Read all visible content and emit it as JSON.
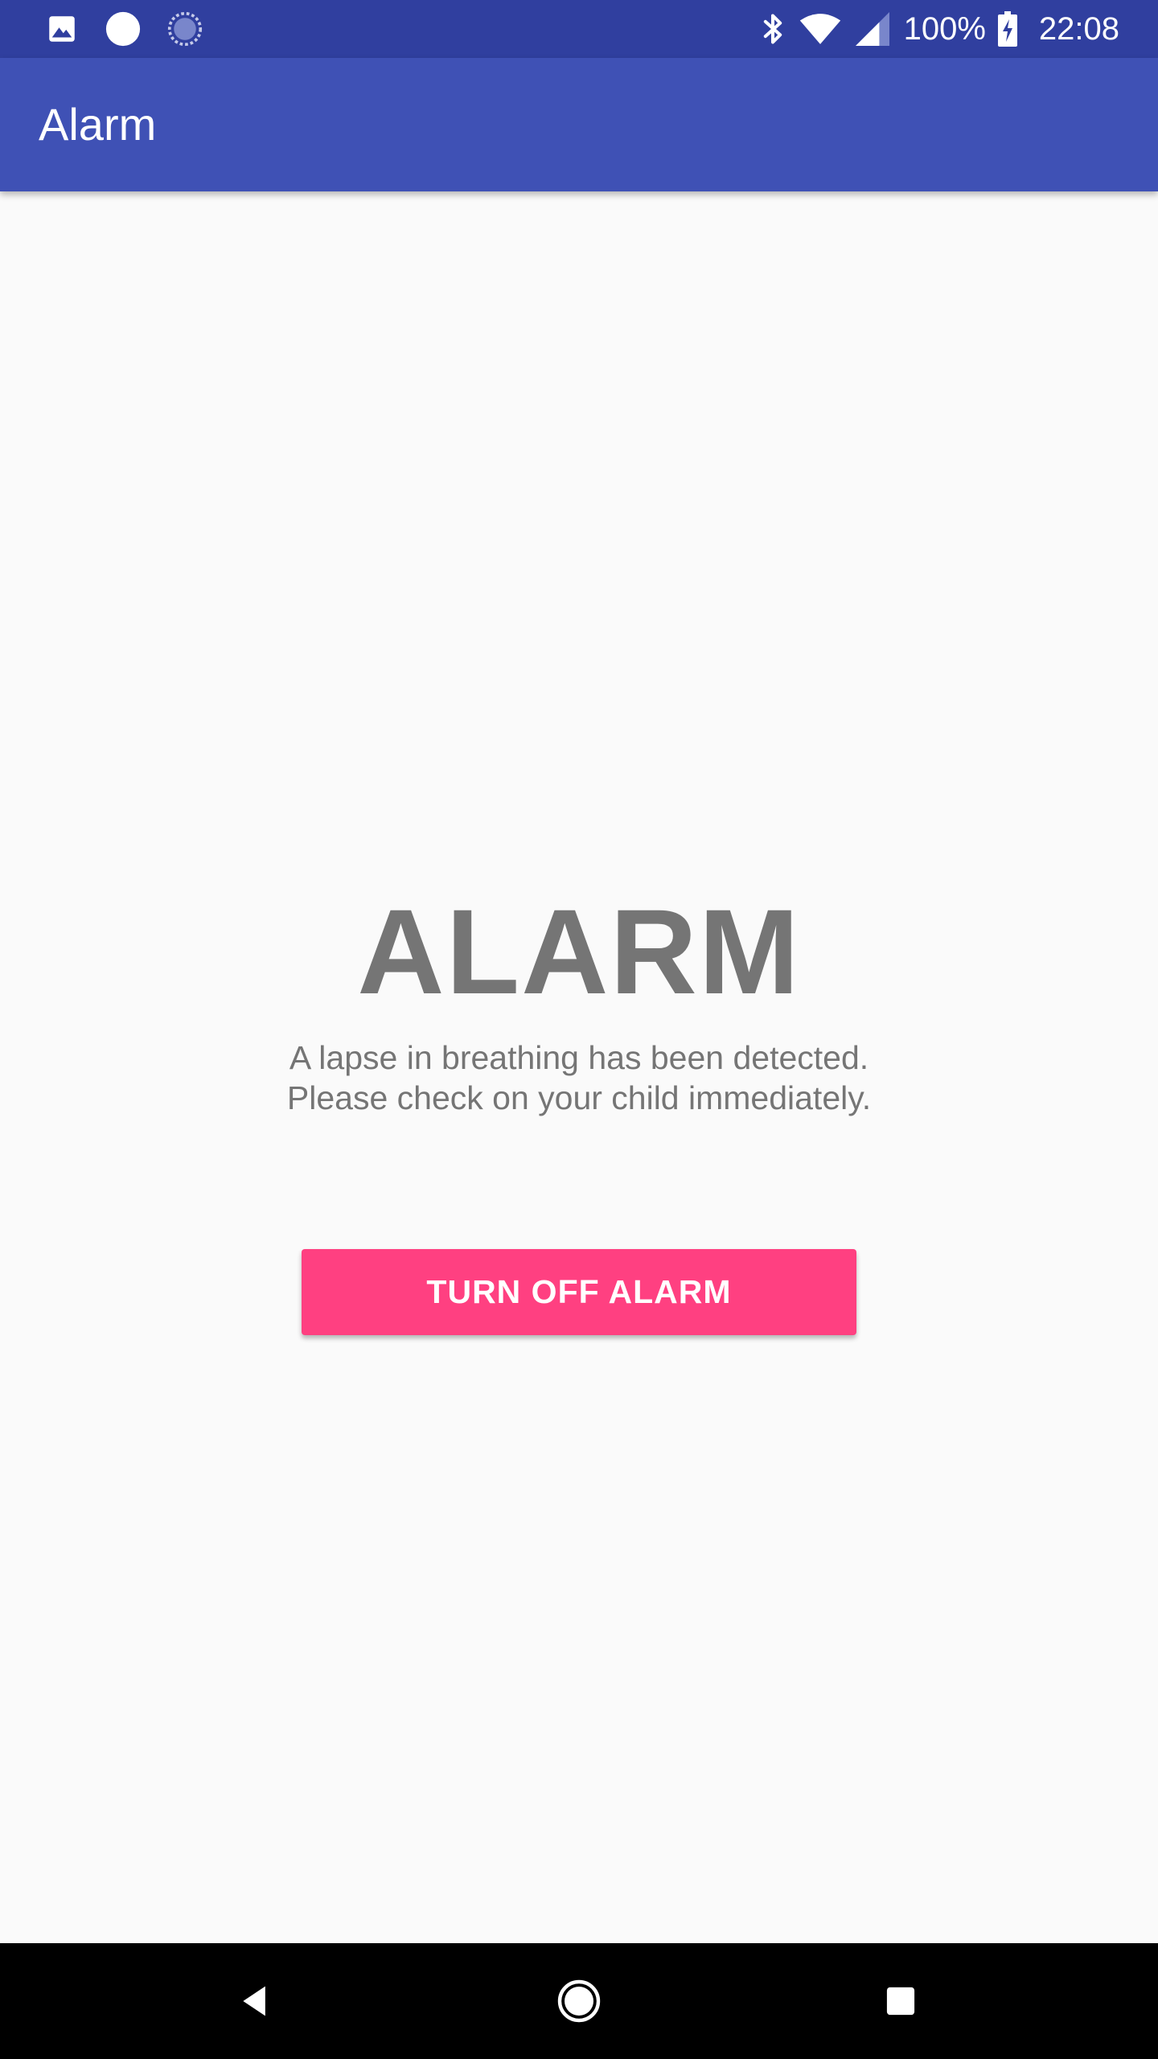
{
  "status_bar": {
    "background": "#303f9f",
    "left_icons": [
      "image-notification-icon",
      "circle-notification-icon",
      "sync-notification-icon"
    ],
    "right_icons": [
      "bluetooth-icon",
      "wifi-icon",
      "cell-signal-icon",
      "battery-charging-icon"
    ],
    "battery": "100%",
    "time": "22:08"
  },
  "app_bar": {
    "title": "Alarm",
    "background": "#3f51b5"
  },
  "main": {
    "heading": "ALARM",
    "message_lines": [
      "A lapse in breathing has been detected.",
      "Please check on your child immediately."
    ],
    "button_label": "TURN OFF ALARM",
    "button_color": "#ff4081",
    "text_color": "#757575",
    "background": "#fafafa"
  },
  "nav_bar": {
    "buttons": [
      "back-icon",
      "home-icon",
      "recents-icon"
    ]
  }
}
